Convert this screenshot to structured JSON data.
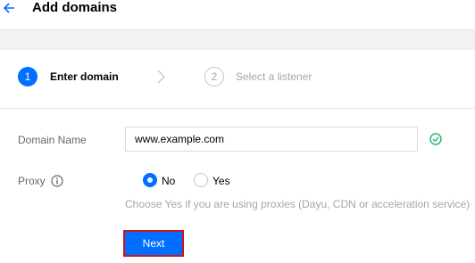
{
  "header": {
    "title": "Add domains",
    "back_icon": "arrow-left-icon"
  },
  "steps": [
    {
      "number": "1",
      "label": "Enter domain",
      "active": true
    },
    {
      "number": "2",
      "label": "Select a listener",
      "active": false
    }
  ],
  "form": {
    "domain_name": {
      "label": "Domain Name",
      "value": "www.example.com",
      "status_icon": "check-circle-icon"
    },
    "proxy": {
      "label": "Proxy",
      "info_icon": "info-icon",
      "options": [
        {
          "label": "No",
          "selected": true
        },
        {
          "label": "Yes",
          "selected": false
        }
      ],
      "hint": "Choose Yes if you are using proxies (Dayu, CDN or acceleration service)"
    }
  },
  "actions": {
    "next_label": "Next"
  },
  "colors": {
    "accent": "#006eff",
    "success": "#2bb673",
    "highlight_border": "#d0121b"
  }
}
